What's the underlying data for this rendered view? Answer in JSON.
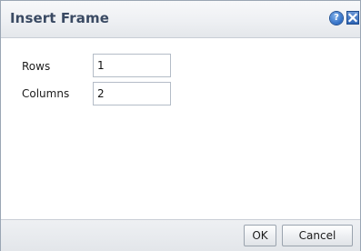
{
  "dialog": {
    "title": "Insert Frame",
    "help_icon": "help-icon",
    "help_glyph": "?",
    "close_icon": "close-icon"
  },
  "form": {
    "rows_label": "Rows",
    "rows_value": "1",
    "columns_label": "Columns",
    "columns_value": "2"
  },
  "footer": {
    "ok_label": "OK",
    "cancel_label": "Cancel"
  },
  "colors": {
    "title_text": "#3a4a63",
    "accent_blue": "#2d64b4"
  }
}
